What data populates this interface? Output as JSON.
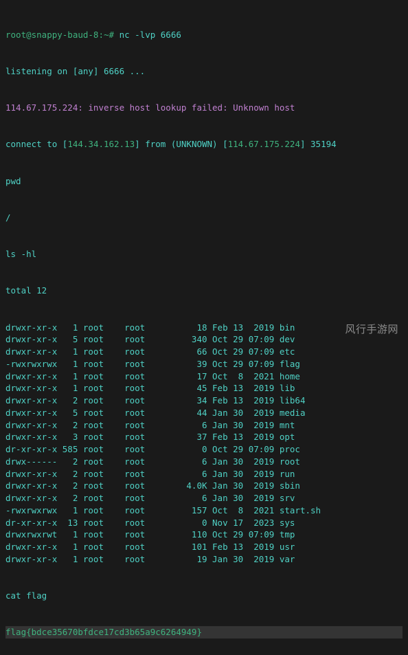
{
  "prompt": {
    "user": "root",
    "host": "snappy-baud-8",
    "path": "~",
    "symbol": "#"
  },
  "cmd_nc": "nc -lvp 6666",
  "out_listening": "listening on [any] 6666 ...",
  "out_error": "114.67.175.224: inverse host lookup failed: Unknown host",
  "out_connect_pre": "connect to [",
  "out_connect_ip1": "144.34.162.13",
  "out_connect_mid": "] from (UNKNOWN) [",
  "out_connect_ip2": "114.67.175.224",
  "out_connect_post": "] 35194",
  "cmd_pwd": "pwd",
  "out_root": "/",
  "cmd_ls": "ls -hl",
  "out_total": "total 12",
  "listing": [
    {
      "perm": "drwxr-xr-x",
      "links": "1",
      "owner": "root",
      "group": "root",
      "size": "18",
      "month": "Feb",
      "day": "13",
      "time": " 2019",
      "name": "bin"
    },
    {
      "perm": "drwxr-xr-x",
      "links": "5",
      "owner": "root",
      "group": "root",
      "size": "340",
      "month": "Oct",
      "day": "29",
      "time": "07:09",
      "name": "dev"
    },
    {
      "perm": "drwxr-xr-x",
      "links": "1",
      "owner": "root",
      "group": "root",
      "size": "66",
      "month": "Oct",
      "day": "29",
      "time": "07:09",
      "name": "etc"
    },
    {
      "perm": "-rwxrwxrwx",
      "links": "1",
      "owner": "root",
      "group": "root",
      "size": "39",
      "month": "Oct",
      "day": "29",
      "time": "07:09",
      "name": "flag"
    },
    {
      "perm": "drwxr-xr-x",
      "links": "1",
      "owner": "root",
      "group": "root",
      "size": "17",
      "month": "Oct",
      "day": " 8",
      "time": " 2021",
      "name": "home"
    },
    {
      "perm": "drwxr-xr-x",
      "links": "1",
      "owner": "root",
      "group": "root",
      "size": "45",
      "month": "Feb",
      "day": "13",
      "time": " 2019",
      "name": "lib"
    },
    {
      "perm": "drwxr-xr-x",
      "links": "2",
      "owner": "root",
      "group": "root",
      "size": "34",
      "month": "Feb",
      "day": "13",
      "time": " 2019",
      "name": "lib64"
    },
    {
      "perm": "drwxr-xr-x",
      "links": "5",
      "owner": "root",
      "group": "root",
      "size": "44",
      "month": "Jan",
      "day": "30",
      "time": " 2019",
      "name": "media"
    },
    {
      "perm": "drwxr-xr-x",
      "links": "2",
      "owner": "root",
      "group": "root",
      "size": "6",
      "month": "Jan",
      "day": "30",
      "time": " 2019",
      "name": "mnt"
    },
    {
      "perm": "drwxr-xr-x",
      "links": "3",
      "owner": "root",
      "group": "root",
      "size": "37",
      "month": "Feb",
      "day": "13",
      "time": " 2019",
      "name": "opt"
    },
    {
      "perm": "dr-xr-xr-x",
      "links": "585",
      "owner": "root",
      "group": "root",
      "size": "0",
      "month": "Oct",
      "day": "29",
      "time": "07:09",
      "name": "proc"
    },
    {
      "perm": "drwx------",
      "links": "2",
      "owner": "root",
      "group": "root",
      "size": "6",
      "month": "Jan",
      "day": "30",
      "time": " 2019",
      "name": "root"
    },
    {
      "perm": "drwxr-xr-x",
      "links": "2",
      "owner": "root",
      "group": "root",
      "size": "6",
      "month": "Jan",
      "day": "30",
      "time": " 2019",
      "name": "run"
    },
    {
      "perm": "drwxr-xr-x",
      "links": "2",
      "owner": "root",
      "group": "root",
      "size": "4.0K",
      "month": "Jan",
      "day": "30",
      "time": " 2019",
      "name": "sbin"
    },
    {
      "perm": "drwxr-xr-x",
      "links": "2",
      "owner": "root",
      "group": "root",
      "size": "6",
      "month": "Jan",
      "day": "30",
      "time": " 2019",
      "name": "srv"
    },
    {
      "perm": "-rwxrwxrwx",
      "links": "1",
      "owner": "root",
      "group": "root",
      "size": "157",
      "month": "Oct",
      "day": " 8",
      "time": " 2021",
      "name": "start.sh"
    },
    {
      "perm": "dr-xr-xr-x",
      "links": "13",
      "owner": "root",
      "group": "root",
      "size": "0",
      "month": "Nov",
      "day": "17",
      "time": " 2023",
      "name": "sys"
    },
    {
      "perm": "drwxrwxrwt",
      "links": "1",
      "owner": "root",
      "group": "root",
      "size": "110",
      "month": "Oct",
      "day": "29",
      "time": "07:09",
      "name": "tmp"
    },
    {
      "perm": "drwxr-xr-x",
      "links": "1",
      "owner": "root",
      "group": "root",
      "size": "101",
      "month": "Feb",
      "day": "13",
      "time": " 2019",
      "name": "usr"
    },
    {
      "perm": "drwxr-xr-x",
      "links": "1",
      "owner": "root",
      "group": "root",
      "size": "19",
      "month": "Jan",
      "day": "30",
      "time": " 2019",
      "name": "var"
    }
  ],
  "cmd_cat": "cat flag",
  "out_flag": "flag{bdce35670bfdce17cd3b65a9c6264949}",
  "watermark": "风行手游网"
}
